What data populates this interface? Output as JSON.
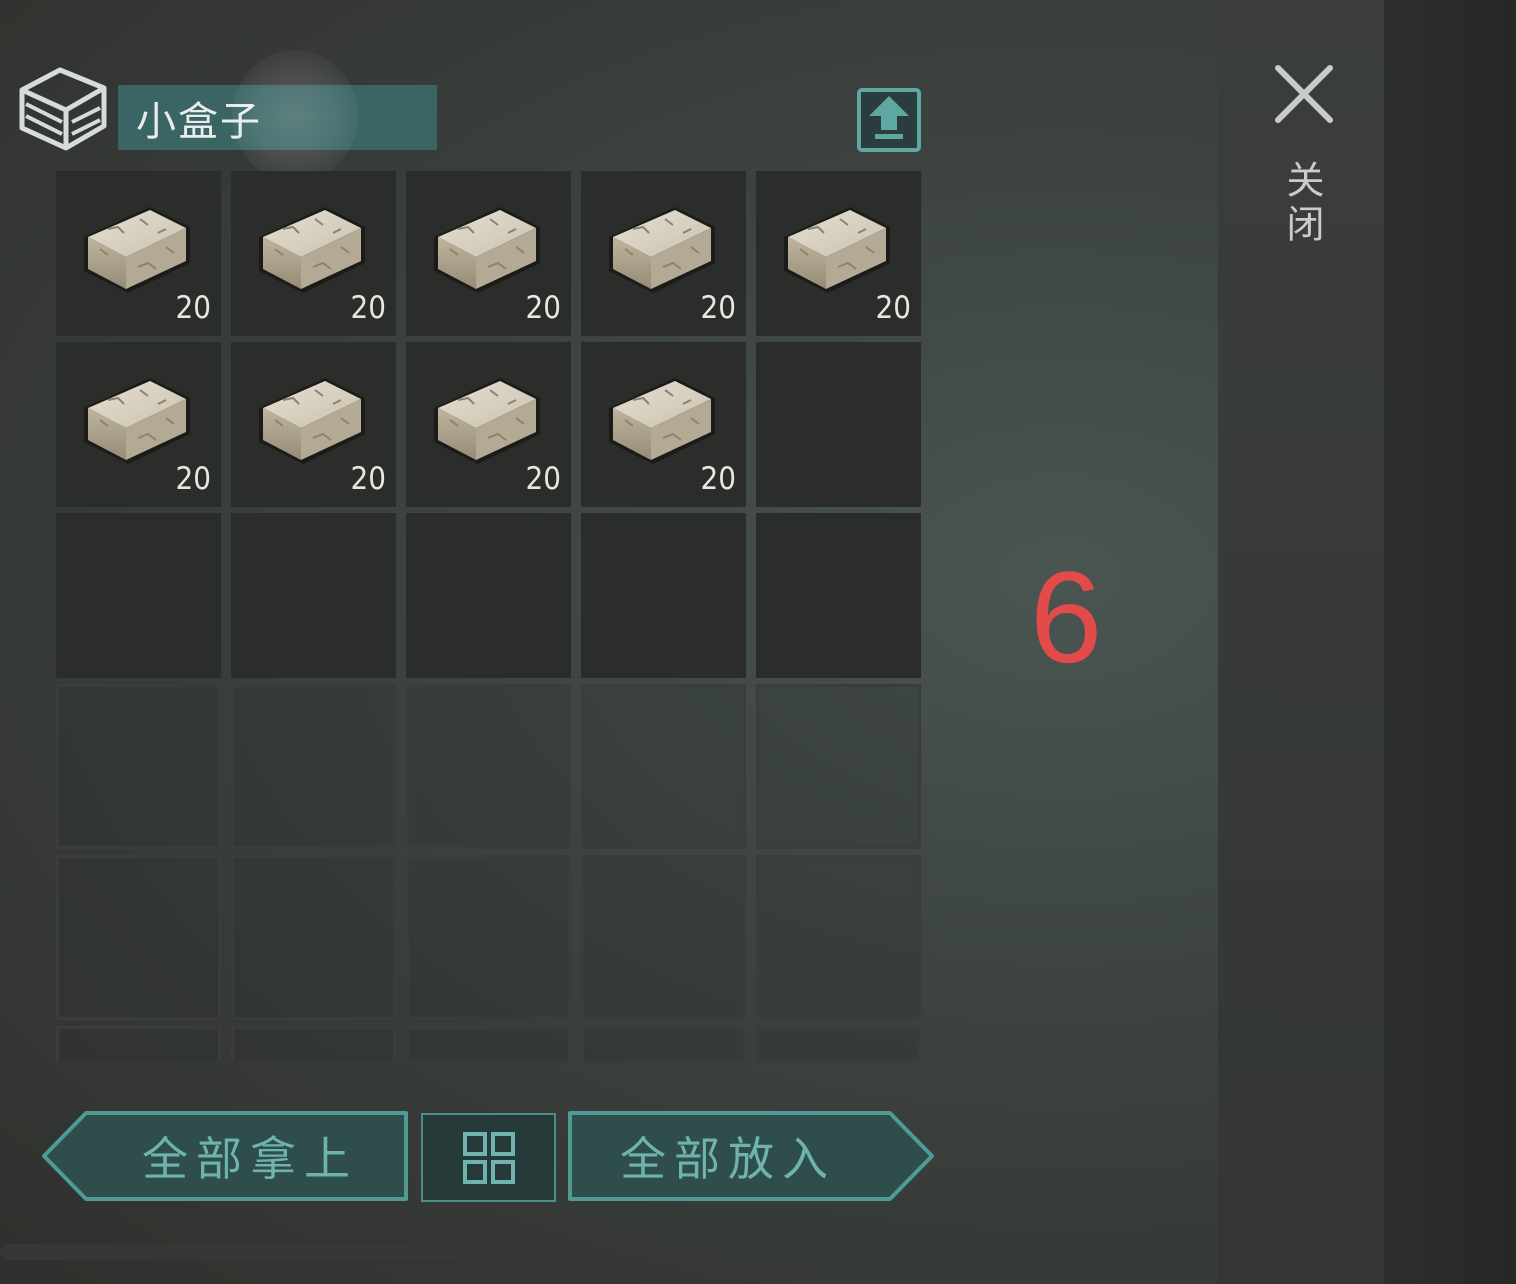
{
  "container": {
    "title": "小盒子",
    "icon": "box-icon",
    "upload_icon": "upload-icon"
  },
  "close": {
    "icon": "close-x-icon",
    "label": "关闭"
  },
  "slots": [
    {
      "item": "stone-block",
      "count": "20"
    },
    {
      "item": "stone-block",
      "count": "20"
    },
    {
      "item": "stone-block",
      "count": "20"
    },
    {
      "item": "stone-block",
      "count": "20"
    },
    {
      "item": "stone-block",
      "count": "20"
    },
    {
      "item": "stone-block",
      "count": "20"
    },
    {
      "item": "stone-block",
      "count": "20"
    },
    {
      "item": "stone-block",
      "count": "20"
    },
    {
      "item": "stone-block",
      "count": "20"
    },
    {
      "item": null,
      "count": ""
    }
  ],
  "buttons": {
    "take_all": "全部拿上",
    "sort_icon": "grid-sort-icon",
    "put_all": "全部放入"
  },
  "annotation": "6",
  "colors": {
    "accent": "#4e8e8a",
    "title_bg": "#3b6564",
    "annotation": "#e34a4a"
  }
}
